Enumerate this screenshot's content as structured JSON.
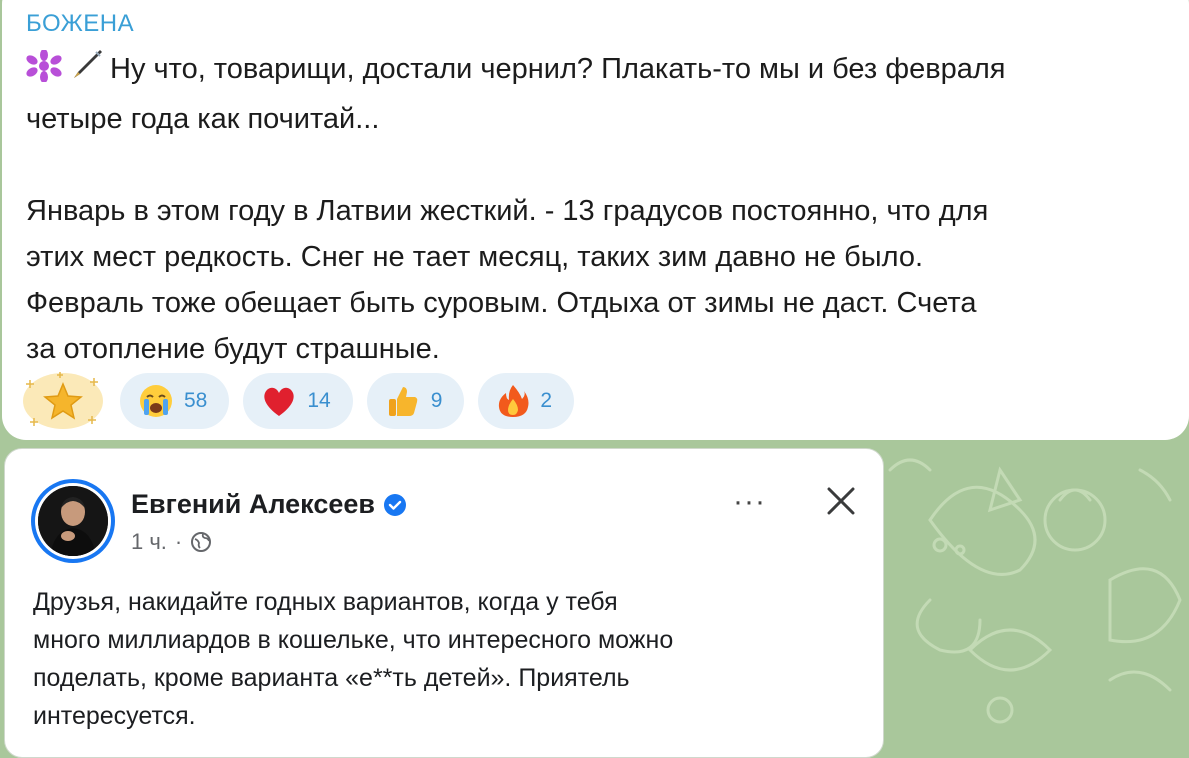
{
  "channel_message": {
    "sender": "БОЖЕНА",
    "lines": [
      "Ну что, товарищи, достали чернил? Плакать-то мы и без февраля",
      "четыре года как почитай...",
      "Январь в этом году в Латвии жесткий. - 13 градусов постоянно, что для",
      "этих мест редкость. Снег не тает месяц, таких зим давно не было.",
      "Февраль тоже обещает быть суровым. Отдыха от зимы не даст. Счета",
      "за отопление будут страшные."
    ],
    "leading_icons": [
      "sparkle-emoji-icon",
      "fountain-pen-emoji-icon"
    ]
  },
  "reactions": [
    {
      "icon": "star-reaction-icon",
      "count": ""
    },
    {
      "icon": "crying-face-icon",
      "count": "58"
    },
    {
      "icon": "heart-icon",
      "count": "14"
    },
    {
      "icon": "thumbs-up-icon",
      "count": "9"
    },
    {
      "icon": "fire-icon",
      "count": "2"
    }
  ],
  "embedded_post": {
    "author": "Евгений Алексеев",
    "time": "1 ч.",
    "separator": "·",
    "more_label": "···",
    "text_lines": [
      "Друзья, накидайте годных вариантов, когда у тебя",
      "много миллиардов в кошельке, что интересного можно",
      "поделать, кроме варианта «е**ть детей». Приятель",
      "интересуется."
    ]
  },
  "colors": {
    "sender": "#3a9fd6",
    "wallpaper": "#a9c79b",
    "reaction_pill": "#e6f0f8",
    "reaction_count": "#3a8fcf",
    "facebook_blue": "#1877f2"
  }
}
